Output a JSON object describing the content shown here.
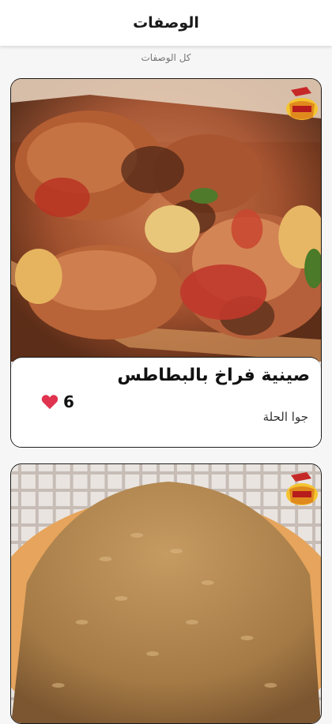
{
  "app": {
    "title": "الوصفات"
  },
  "breadcrumb": "كل الوصفات",
  "cards": [
    {
      "title": "صينية فراخ بالبطاطس",
      "author": "جوا الحلة",
      "likes": "6",
      "icon": "heart-icon",
      "image": "chicken-potato-tray-photo"
    },
    {
      "image": "brown-rice-photo"
    }
  ],
  "colors": {
    "heart": "#e0334f",
    "border": "#1c1c1c",
    "app_bar": "#ffffff"
  }
}
